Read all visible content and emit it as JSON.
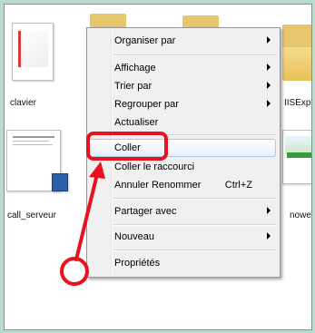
{
  "desktop": {
    "items": [
      {
        "label": "clavier"
      },
      {
        "label": "IISExpre"
      },
      {
        "label": "call_serveur"
      },
      {
        "label": "nowe"
      }
    ]
  },
  "context_menu": {
    "items": [
      {
        "label": "Organiser par",
        "submenu": true
      },
      {
        "label": "Affichage",
        "submenu": true
      },
      {
        "label": "Trier par",
        "submenu": true
      },
      {
        "label": "Regrouper par",
        "submenu": true
      },
      {
        "label": "Actualiser",
        "submenu": false
      },
      {
        "label": "Coller",
        "submenu": false,
        "highlighted": true
      },
      {
        "label": "Coller le raccourci",
        "submenu": false
      },
      {
        "label": "Annuler Renommer",
        "shortcut": "Ctrl+Z"
      },
      {
        "label": "Partager avec",
        "submenu": true
      },
      {
        "label": "Nouveau",
        "submenu": true
      },
      {
        "label": "Propriétés",
        "submenu": false
      }
    ]
  },
  "annotation": {
    "color": "#e8111d"
  }
}
